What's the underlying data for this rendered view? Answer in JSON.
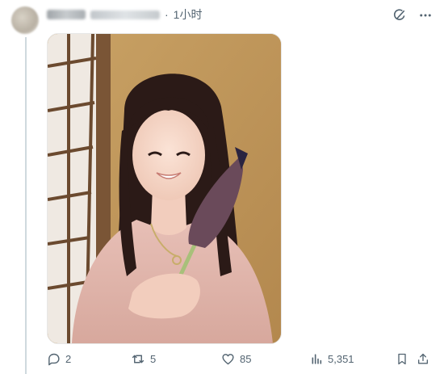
{
  "post": {
    "timestamp": "1小时",
    "separator": "·"
  },
  "icons": {
    "grok": "grok-icon",
    "more": "more-icon",
    "reply": "reply-icon",
    "repost": "repost-icon",
    "like": "like-icon",
    "views": "views-icon",
    "bookmark": "bookmark-icon",
    "share": "share-icon"
  },
  "stats": {
    "replies": "2",
    "reposts": "5",
    "likes": "85",
    "views": "5,351"
  },
  "colors": {
    "muted": "#536471",
    "thread_line": "#cfd9de"
  }
}
